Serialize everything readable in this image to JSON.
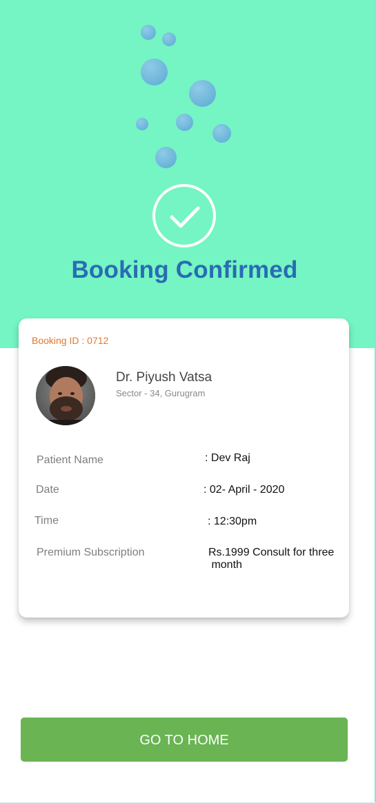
{
  "header": {
    "title": "Booking Confirmed"
  },
  "icons": {
    "success": "check-circle-icon",
    "decoration": "bubbles-decoration"
  },
  "colors": {
    "hero_background": "#74f5c3",
    "title": "#2a6bb3",
    "booking_id": "#e0782c",
    "button": "#6ab454"
  },
  "booking": {
    "id_label": "Booking ID : 0712",
    "doctor": {
      "name": "Dr. Piyush Vatsa",
      "address": "Sector - 34, Gurugram"
    },
    "rows": [
      {
        "label": "Patient Name",
        "value": ": Dev Raj"
      },
      {
        "label": "Date",
        "value": ": 02- April - 2020"
      },
      {
        "label": "Time",
        "value": ": 12:30pm"
      },
      {
        "label": "Premium Subscription",
        "value_line1": "Rs.1999 Consult for three",
        "value_line2": " month"
      }
    ]
  },
  "actions": {
    "home_label": "GO TO HOME"
  }
}
